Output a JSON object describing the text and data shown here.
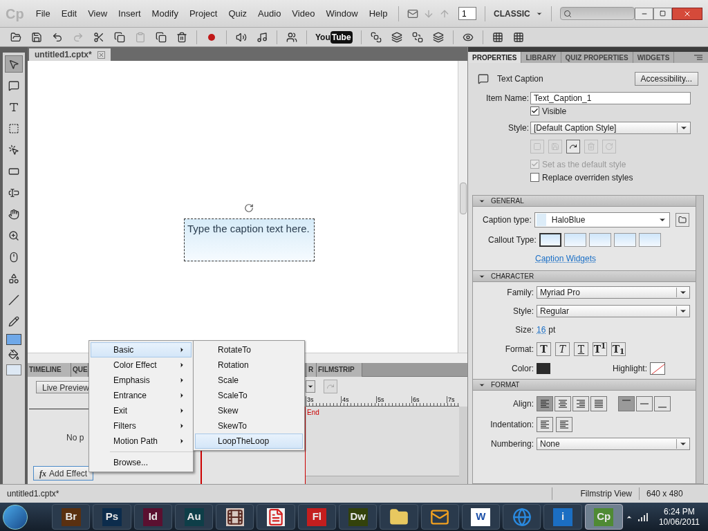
{
  "app": {
    "logo": "Cp",
    "menus": [
      "File",
      "Edit",
      "View",
      "Insert",
      "Modify",
      "Project",
      "Quiz",
      "Audio",
      "Video",
      "Window",
      "Help"
    ],
    "page_field": "1",
    "workspace": "CLASSIC"
  },
  "toolbar": {
    "youtube": [
      "You",
      "Tube"
    ]
  },
  "tools": [
    {
      "kind": "pointer",
      "selected": true
    },
    {
      "kind": "caption",
      "selected": false
    },
    {
      "kind": "rollover-caption",
      "selected": false
    },
    {
      "kind": "highlight-box",
      "selected": false
    },
    {
      "kind": "click-box",
      "selected": false
    },
    {
      "kind": "button",
      "selected": false
    },
    {
      "kind": "text-entry",
      "selected": false
    },
    {
      "kind": "rollover-area",
      "selected": false
    },
    {
      "kind": "zoom-area",
      "selected": false
    },
    {
      "kind": "mouse",
      "selected": false
    },
    {
      "kind": "widget",
      "selected": false
    },
    {
      "kind": "line",
      "selected": false
    },
    {
      "kind": "pencil",
      "selected": false
    }
  ],
  "document_tab": {
    "label": "untitled1.cptx*"
  },
  "caption": {
    "text": "Type the caption text here."
  },
  "timeline": {
    "tabs": [
      {
        "label": "TIMELINE",
        "selected": false
      },
      {
        "label": "QUE",
        "selected": false
      },
      {
        "label": "R",
        "selected": false
      },
      {
        "label": "FILMSTRIP",
        "selected": false
      }
    ],
    "live_preview": "Live Preview",
    "empty_text": "No p",
    "add_effect": "Add Effect",
    "fx": "fx",
    "ruler": [
      "3s",
      "4s",
      "5s",
      "6s",
      "7s"
    ],
    "end_marker": "End"
  },
  "effect_menu": {
    "items": [
      {
        "label": "Basic",
        "selected": true
      },
      {
        "label": "Color Effect",
        "selected": false
      },
      {
        "label": "Emphasis",
        "selected": false
      },
      {
        "label": "Entrance",
        "selected": false
      },
      {
        "label": "Exit",
        "selected": false
      },
      {
        "label": "Filters",
        "selected": false
      },
      {
        "label": "Motion Path",
        "selected": false
      }
    ],
    "browse": "Browse..."
  },
  "submenu": {
    "items": [
      {
        "label": "RotateTo",
        "selected": false
      },
      {
        "label": "Rotation",
        "selected": false
      },
      {
        "label": "Scale",
        "selected": false
      },
      {
        "label": "ScaleTo",
        "selected": false
      },
      {
        "label": "Skew",
        "selected": false
      },
      {
        "label": "SkewTo",
        "selected": false
      },
      {
        "label": "LoopTheLoop",
        "selected": true
      }
    ]
  },
  "properties": {
    "tabs": [
      {
        "label": "PROPERTIES",
        "selected": true
      },
      {
        "label": "LIBRARY",
        "selected": false
      },
      {
        "label": "QUIZ PROPERTIES",
        "selected": false
      },
      {
        "label": "WIDGETS",
        "selected": false
      }
    ],
    "object_type": "Text Caption",
    "accessibility": "Accessibility...",
    "item_name": {
      "label": "Item Name:",
      "value": "Text_Caption_1"
    },
    "visible": {
      "label": "Visible",
      "checked": true,
      "disabled": false
    },
    "style": {
      "label": "Style:",
      "value": "[Default Caption Style]"
    },
    "set_default": {
      "label": "Set as the default style",
      "checked": true,
      "disabled": true
    },
    "replace_overriden": {
      "label": "Replace overriden styles",
      "checked": false,
      "disabled": false
    },
    "general": {
      "title": "GENERAL",
      "expanded": true,
      "caption_type_label": "Caption type:",
      "caption_type": "HaloBlue",
      "callout_label": "Callout Type:",
      "callouts": [
        {
          "selected": true
        },
        {
          "selected": false
        },
        {
          "selected": false
        },
        {
          "selected": false
        },
        {
          "selected": false
        }
      ],
      "link": "Caption Widgets"
    },
    "character": {
      "title": "CHARACTER",
      "expanded": true,
      "family_label": "Family:",
      "family": "Myriad Pro",
      "style_label": "Style:",
      "style": "Regular",
      "size_label": "Size:",
      "size": "16",
      "size_unit": "pt",
      "format_label": "Format:",
      "formats": [
        {
          "kind": "bold",
          "glyph": "T",
          "selected": false
        },
        {
          "kind": "italic",
          "glyph": "T",
          "selected": false
        },
        {
          "kind": "underline",
          "glyph": "T",
          "selected": false
        },
        {
          "kind": "superscript",
          "glyph": "T$^{1}$",
          "selected": false
        },
        {
          "kind": "subscript",
          "glyph": "T$_{1}$",
          "selected": false
        }
      ],
      "color_label": "Color:",
      "color": "#2b2b2b",
      "highlight_label": "Highlight:"
    },
    "format": {
      "title": "FORMAT",
      "expanded": true,
      "align_label": "Align:",
      "aligns": [
        {
          "kind": "left",
          "selected": true
        },
        {
          "kind": "center",
          "selected": false
        },
        {
          "kind": "right",
          "selected": false
        },
        {
          "kind": "justify",
          "selected": false
        }
      ],
      "valigns": [
        {
          "kind": "top",
          "selected": true
        },
        {
          "kind": "middle",
          "selected": false
        },
        {
          "kind": "bottom",
          "selected": false
        }
      ],
      "indent_label": "Indentation:",
      "numbering_label": "Numbering:",
      "numbering": "None"
    }
  },
  "status_bar": {
    "file": "untitled1.cptx*",
    "view": "Filmstrip View",
    "size": "640 x 480"
  },
  "taskbar": {
    "apps": [
      {
        "kind": "text",
        "label": "Br",
        "color": "#5a3010",
        "selected": false
      },
      {
        "kind": "text",
        "label": "Ps",
        "color": "#0c2c4c",
        "selected": false
      },
      {
        "kind": "text",
        "label": "Id",
        "color": "#5a1030",
        "selected": false
      },
      {
        "kind": "text",
        "label": "Au",
        "color": "#0e3e48",
        "selected": false
      },
      {
        "kind": "film",
        "color": "#5a2a22",
        "selected": false
      },
      {
        "kind": "pdf",
        "color": "#f2f2f2",
        "selected": false
      },
      {
        "kind": "text",
        "label": "Fl",
        "color": "#c41e1e",
        "selected": false
      },
      {
        "kind": "text",
        "label": "Dw",
        "color": "#33420c",
        "selected": false
      },
      {
        "kind": "folder",
        "color": "#e8c860",
        "selected": false
      },
      {
        "kind": "mail",
        "color": "#f0a020",
        "selected": false
      },
      {
        "kind": "text",
        "label": "W",
        "color": "#ffffff",
        "selected": false
      },
      {
        "kind": "browser",
        "color": "#2a8ae0",
        "selected": false
      },
      {
        "kind": "text",
        "label": "i",
        "color": "#1b6ec2",
        "selected": false
      },
      {
        "kind": "text",
        "label": "Cp",
        "color": "#4f8a34",
        "selected": true
      }
    ],
    "clock": {
      "time": "6:24 PM",
      "date": "10/06/2011"
    }
  }
}
